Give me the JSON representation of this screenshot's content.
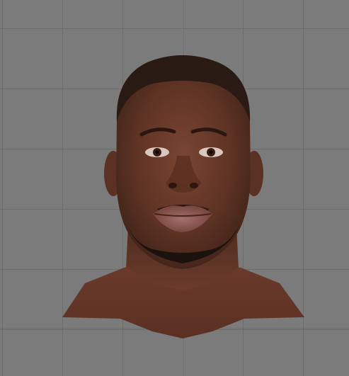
{
  "viewport": {
    "background_color": "#7b7b7b",
    "grid_color": "#6c6c6c",
    "y_axis_color": "#5fa05f",
    "x_axis_color": "#a05a5a"
  },
  "model": {
    "subject": "3d-head-mesh",
    "skin_color": "#6a3a2a",
    "hair_color": "#2a1a14"
  }
}
